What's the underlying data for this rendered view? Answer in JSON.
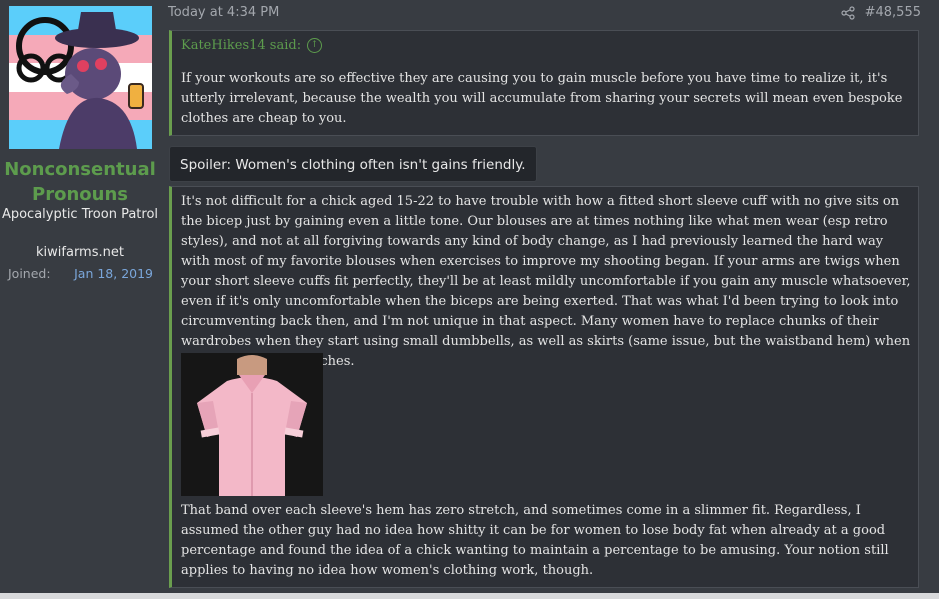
{
  "user": {
    "name": "Nonconsentual Pronouns",
    "title": "Apocalyptic Troon Patrol",
    "site": "kiwifarms.net",
    "joined_label": "Joined:",
    "joined_date": "Jan 18, 2019"
  },
  "post": {
    "date": "Today at 4:34 PM",
    "number": "#48,555",
    "quote": {
      "author_label": "KateHikes14 said:",
      "text": "If your workouts are so effective they are causing you to gain muscle before you have time to realize it, it's utterly irrelevant, because the wealth you will accumulate from sharing your secrets will mean even bespoke clothes are cheap to you."
    },
    "spoiler_label": "Spoiler: Women's clothing often isn't gains friendly.",
    "spoiler_text_1": "It's not difficult for a chick aged 15-22 to have trouble with how a fitted short sleeve cuff with no give sits on the bicep just by gaining even a little tone. Our blouses are at times nothing like what men wear (esp retro styles), and not at all forgiving towards any kind of body change, as I had previously learned the hard way with most of my favorite blouses when exercises to improve my shooting began. If your arms are twigs when your short sleeve cuffs fit perfectly, they'll be at least mildly uncomfortable if you gain any muscle whatsoever, even if it's only uncomfortable when the biceps are being exerted. That was what I'd been trying to look into circumventing back then, and I'm not unique in that aspect. Many women have to replace chunks of their wardrobes when they start using small dumbbells, as well as skirts (same issue, but the waistband hem) when they start doing crunches.",
    "spoiler_text_2": "That band over each sleeve's hem has zero stretch, and sometimes come in a slimmer fit. Regardless, I assumed the other guy had no idea how shitty it can be for women to lose body fat when already at a good percentage and found the idea of a chick wanting to maintain a percentage to be amusing. Your notion still applies to having no idea how women's clothing work, though."
  },
  "colors": {
    "accent_green": "#5d9c4d",
    "link_blue": "#7aa6da",
    "background": "#383c42"
  }
}
